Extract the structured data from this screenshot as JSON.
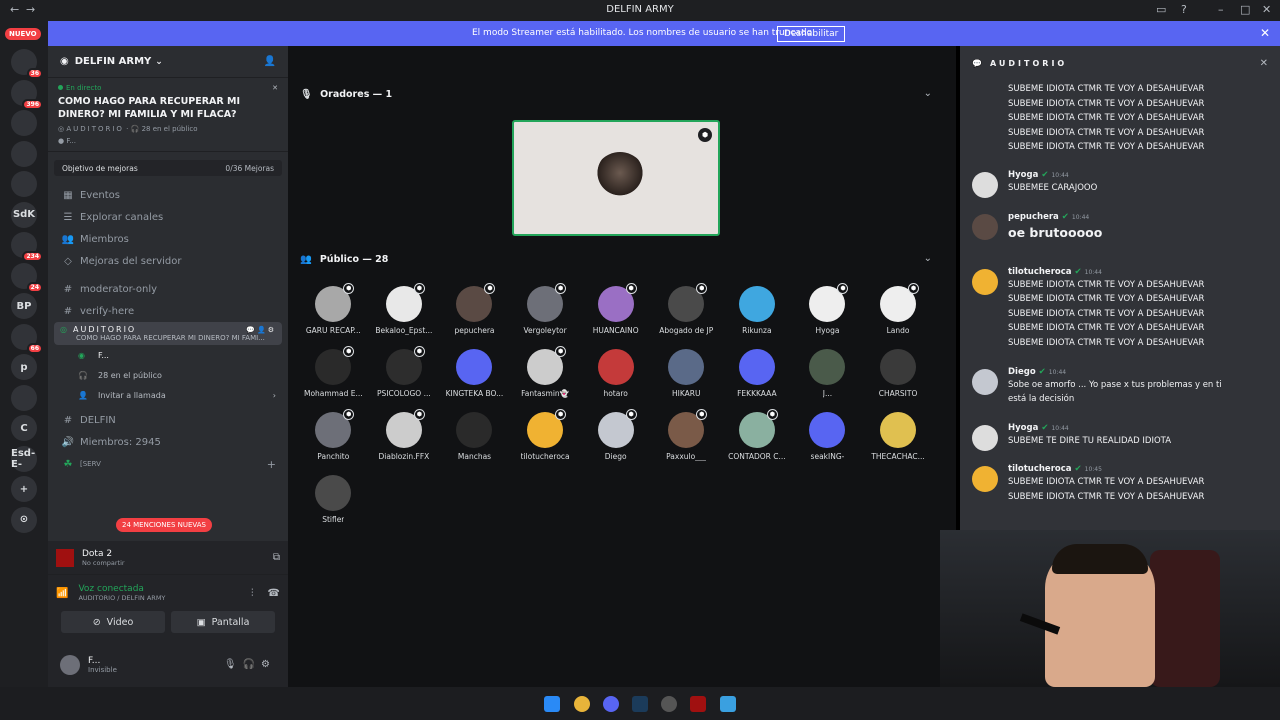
{
  "window": {
    "title": "DELFIN ARMY"
  },
  "banner": {
    "message": "El modo Streamer está habilitado. Los nombres de usuario se han truncado.",
    "button": "Deshabilitar"
  },
  "servers": {
    "nuevo": "NUEVO",
    "items": [
      {
        "label": "",
        "badge": "36"
      },
      {
        "label": "",
        "badge": "396"
      },
      {
        "label": "",
        "badge": ""
      },
      {
        "label": "",
        "badge": ""
      },
      {
        "label": "",
        "badge": ""
      },
      {
        "label": "SdK",
        "badge": ""
      },
      {
        "label": "",
        "badge": "234"
      },
      {
        "label": "",
        "badge": "24"
      },
      {
        "label": "BP",
        "badge": ""
      },
      {
        "label": "",
        "badge": "66"
      },
      {
        "label": "p",
        "badge": ""
      },
      {
        "label": "",
        "badge": ""
      },
      {
        "label": "C",
        "badge": ""
      },
      {
        "label": "Esd-E-",
        "badge": ""
      },
      {
        "label": "+",
        "badge": ""
      },
      {
        "label": "⊙",
        "badge": ""
      }
    ]
  },
  "sidebar": {
    "guild": "DELFIN ARMY",
    "live": {
      "tag": "En directo",
      "title": "COMO HAGO PARA RECUPERAR MI DINERO? MI FAMILIA Y MI FLACA?",
      "channel": "AUDITORIO",
      "audience": "28 en el público",
      "host": "F..."
    },
    "boost": {
      "label": "Objetivo de mejoras",
      "value": "0/36 Mejoras"
    },
    "nav": [
      "Eventos",
      "Explorar canales",
      "Miembros",
      "Mejoras del servidor"
    ],
    "channels": [
      "moderator-only",
      "verify-here"
    ],
    "stage": {
      "name": "AUDITORIO",
      "topic": "COMO HAGO PARA RECUPERAR MI DINERO? MI FAMI...",
      "user": "F...",
      "audience": "28 en el público",
      "invite": "Invitar a llamada"
    },
    "category": "DELFIN",
    "members": "Miembros: 2945",
    "serv": "[SERV",
    "mentions": "24 MENCIONES NUEVAS"
  },
  "voice": {
    "game": "Dota 2",
    "game_status": "No compartir",
    "status": "Voz conectada",
    "location": "AUDITORIO / DELFIN ARMY",
    "video": "Video",
    "screen": "Pantalla"
  },
  "user": {
    "name": "F...",
    "status": "Invisible"
  },
  "stage": {
    "speakers_label": "Oradores — 1",
    "audience_label": "Público — 28",
    "audience": [
      {
        "name": "GARU RECAP...",
        "color": "#a8a8a8",
        "mod": true
      },
      {
        "name": "Bekaloo_Epst...",
        "color": "#e8e8e8",
        "mod": true
      },
      {
        "name": "pepuchera",
        "color": "#5a4a44",
        "mod": true
      },
      {
        "name": "Vergoleytor",
        "color": "#6d6f78",
        "mod": true
      },
      {
        "name": "HUANCAINO",
        "color": "#9a6fc4",
        "mod": true
      },
      {
        "name": "Abogado de JP",
        "color": "#4a4a4a",
        "mod": true
      },
      {
        "name": "Rikunza",
        "color": "#3fa7e0",
        "mod": false
      },
      {
        "name": "Hyoga",
        "color": "#eeeeee",
        "mod": true
      },
      {
        "name": "Lando",
        "color": "#eeeeee",
        "mod": true
      },
      {
        "name": "Mohammad E...",
        "color": "#2a2a2a",
        "mod": true
      },
      {
        "name": "PSICOLOGO ...",
        "color": "#2d2d2d",
        "mod": true
      },
      {
        "name": "KINGTEKA BO...",
        "color": "#5865f2",
        "mod": false
      },
      {
        "name": "Fantasmin👻",
        "color": "#cccccc",
        "mod": true
      },
      {
        "name": "hotaro",
        "color": "#c43a3a",
        "mod": false
      },
      {
        "name": "HIKARU",
        "color": "#5a6a88",
        "mod": false
      },
      {
        "name": "FEKKKAAA",
        "color": "#5865f2",
        "mod": false
      },
      {
        "name": "J...",
        "color": "#4a5a4a",
        "mod": false
      },
      {
        "name": "CHARSITO",
        "color": "#3a3a3a",
        "mod": false
      },
      {
        "name": "Panchito",
        "color": "#6d6f78",
        "mod": true
      },
      {
        "name": "Diablozin.FFX",
        "color": "#cccccc",
        "mod": true
      },
      {
        "name": "Manchas",
        "color": "#2a2a2a",
        "mod": false
      },
      {
        "name": "tilotucheroca",
        "color": "#f0b232",
        "mod": true
      },
      {
        "name": "Diego",
        "color": "#c4c8d0",
        "mod": true
      },
      {
        "name": "Paxxulo___",
        "color": "#7a5a48",
        "mod": true
      },
      {
        "name": "CONTADOR C...",
        "color": "#8ab0a0",
        "mod": true
      },
      {
        "name": "seakING-",
        "color": "#5865f2",
        "mod": false
      },
      {
        "name": "THECACHAC...",
        "color": "#e0c050",
        "mod": false
      },
      {
        "name": "Stifler",
        "color": "#4a4a4a",
        "mod": false
      }
    ]
  },
  "chat": {
    "title": "AUDITORIO",
    "top_lines": [
      "SUBEME IDIOTA CTMR TE VOY A DESAHUEVAR",
      "SUBEME IDIOTA CTMR TE VOY A DESAHUEVAR",
      "SUBEME IDIOTA CTMR TE VOY A DESAHUEVAR",
      "SUBEME IDIOTA CTMR TE VOY A DESAHUEVAR",
      "SUBEME IDIOTA CTMR TE VOY A DESAHUEVAR"
    ],
    "messages": [
      {
        "author": "Hyoga",
        "time": "10:44",
        "lines": [
          "SUBEMEE CARAJOOO"
        ],
        "big": false,
        "color": "#dddddd"
      },
      {
        "author": "pepuchera",
        "time": "10:44",
        "lines": [
          "oe brutooooo"
        ],
        "big": true,
        "color": "#5a4a44"
      },
      {
        "author": "tilotucheroca",
        "time": "10:44",
        "lines": [
          "SUBEME IDIOTA CTMR TE VOY A DESAHUEVAR",
          "SUBEME IDIOTA CTMR TE VOY A DESAHUEVAR",
          "SUBEME IDIOTA CTMR TE VOY A DESAHUEVAR",
          "SUBEME IDIOTA CTMR TE VOY A DESAHUEVAR",
          "SUBEME IDIOTA CTMR TE VOY A DESAHUEVAR"
        ],
        "big": false,
        "color": "#f0b232"
      },
      {
        "author": "Diego",
        "time": "10:44",
        "lines": [
          "Sobe oe amorfo ... Yo pase x tus problemas y en ti",
          "está la decisión"
        ],
        "big": false,
        "color": "#c4c8d0"
      },
      {
        "author": "Hyoga",
        "time": "10:44",
        "lines": [
          "SUBEME TE DIRE TU REALIDAD IDIOTA"
        ],
        "big": false,
        "color": "#dddddd"
      },
      {
        "author": "tilotucheroca",
        "time": "10:45",
        "lines": [
          "SUBEME IDIOTA CTMR TE VOY A DESAHUEVAR",
          "SUBEME IDIOTA CTMR TE VOY A DESAHUEVAR"
        ],
        "big": false,
        "color": "#f0b232"
      }
    ]
  }
}
